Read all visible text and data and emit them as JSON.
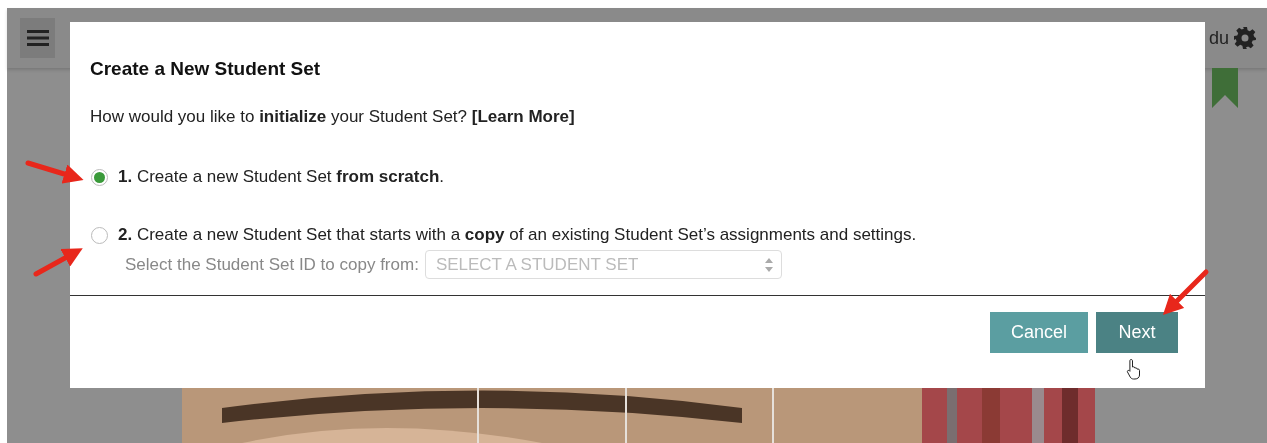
{
  "header": {
    "user_text": "du"
  },
  "dialog": {
    "title": "Create a New Student Set",
    "prompt": "How would you like to **initialize** your Student Set?",
    "learn_more": "[Learn More]",
    "options": [
      {
        "text": "**1.** Create a new Student Set **from scratch**.",
        "selected": true
      },
      {
        "text": "**2.** Create a new Student Set that starts with a **copy** of an existing Student Set’s assignments and settings.",
        "selected": false
      }
    ],
    "copy_select": {
      "label": "Select the Student Set ID to copy from:",
      "placeholder": "SELECT A STUDENT SET"
    },
    "buttons": [
      {
        "label": "Cancel",
        "kind": "secondary"
      },
      {
        "label": "Next",
        "kind": "primary"
      }
    ]
  }
}
